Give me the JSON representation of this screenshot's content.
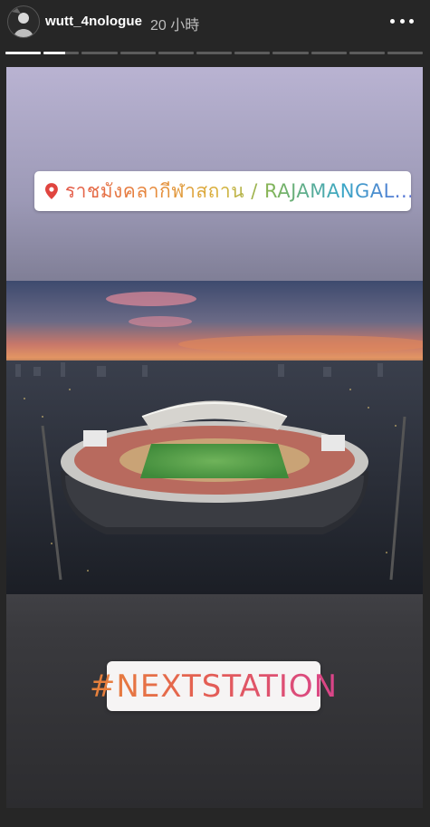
{
  "header": {
    "username": "wutt_4nologue",
    "timestamp": "20 小時",
    "more_icon": "more-horizontal-icon"
  },
  "progress": {
    "total_segments": 11,
    "current_index": 1,
    "current_fraction": 0.6
  },
  "story": {
    "location_sticker": {
      "icon": "location-pin-icon",
      "text": "ราชมังคลากีฬาสถาน / RAJAMANGAL..."
    },
    "photo": {
      "icon": "stadium-photo"
    },
    "hashtag_sticker": {
      "text": "#NEXTSTATION"
    }
  },
  "colors": {
    "background": "#262626",
    "progress_active": "#f2f2f2",
    "progress_inactive": "#5c5c5c",
    "hashtag_gradient_start": "#e7833a",
    "hashtag_gradient_end": "#d9448a"
  }
}
